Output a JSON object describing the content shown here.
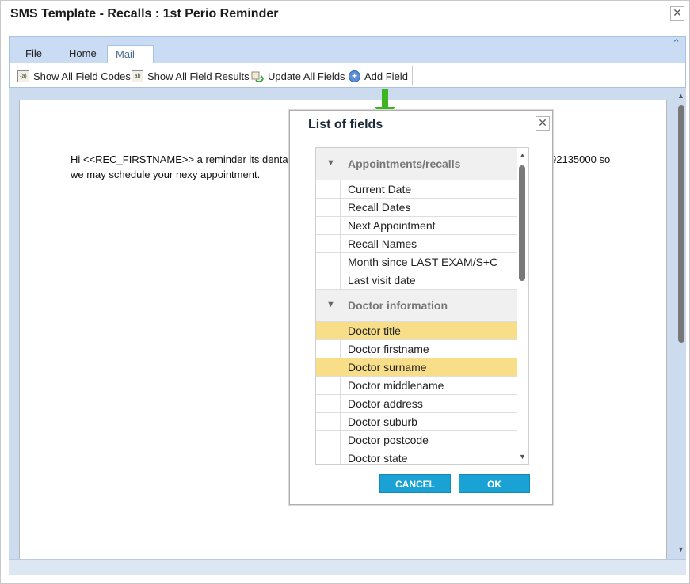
{
  "window": {
    "title": "SMS Template - Recalls : 1st Perio Reminder",
    "close_glyph": "✕"
  },
  "ribbon": {
    "tabs": [
      {
        "label": "File"
      },
      {
        "label": "Home"
      },
      {
        "label": "Mail Merge"
      }
    ],
    "active_tab": "Mail Merge",
    "collapse_glyph": "⌃",
    "toolbar": {
      "show_codes": "Show All Field Codes",
      "show_results": "Show All Field Results",
      "update_fields": "Update All Fields",
      "add_field": "Add Field"
    }
  },
  "document": {
    "text": "Hi <<REC_FIRSTNAME>> a reminder its dental",
    "text_line2": "we may schedule your nexy appointment.",
    "text_tail": "92135000 so"
  },
  "dialog": {
    "title": "List of fields",
    "close_glyph": "✕",
    "groups": [
      {
        "label": "Appointments/recalls",
        "items": [
          "Current Date",
          "Recall Dates",
          "Next Appointment",
          "Recall Names",
          "Month since LAST EXAM/S+C",
          "Last visit date"
        ]
      },
      {
        "label": "Doctor information",
        "items": [
          "Doctor title",
          "Doctor firstname",
          "Doctor surname",
          "Doctor middlename",
          "Doctor address",
          "Doctor suburb",
          "Doctor postcode",
          "Doctor state"
        ]
      }
    ],
    "highlighted_items": [
      "Doctor title",
      "Doctor surname"
    ],
    "cancel_label": "CANCEL",
    "ok_label": "OK"
  },
  "colors": {
    "ribbon_bg": "#c9dcf4",
    "highlight": "#f9de8a",
    "button": "#1ba2d4",
    "arrow": "#3cb521"
  }
}
